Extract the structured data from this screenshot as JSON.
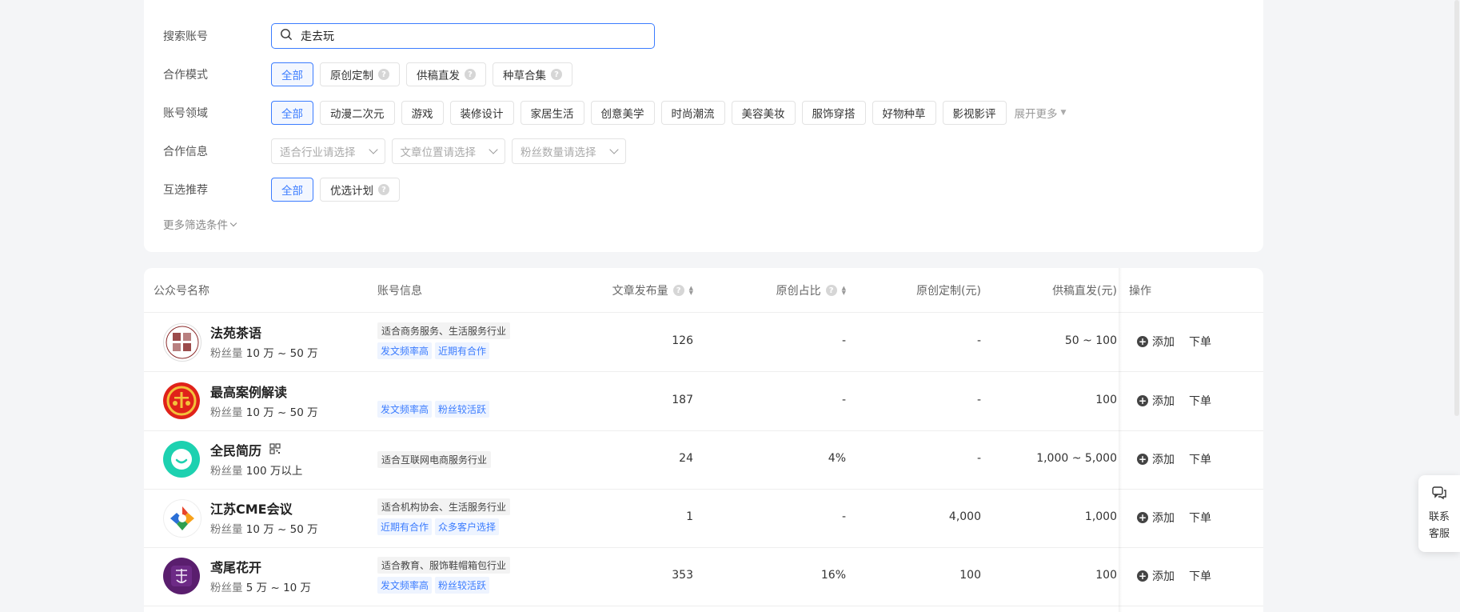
{
  "filters": {
    "search": {
      "label": "搜索账号",
      "value": "走去玩"
    },
    "coop_mode": {
      "label": "合作模式",
      "options": [
        {
          "label": "全部",
          "active": true,
          "help": false
        },
        {
          "label": "原创定制",
          "active": false,
          "help": true
        },
        {
          "label": "供稿直发",
          "active": false,
          "help": true
        },
        {
          "label": "种草合集",
          "active": false,
          "help": true
        }
      ]
    },
    "domain": {
      "label": "账号领域",
      "options": [
        "全部",
        "动漫二次元",
        "游戏",
        "装修设计",
        "家居生活",
        "创意美学",
        "时尚潮流",
        "美容美妆",
        "服饰穿搭",
        "好物种草",
        "影视影评"
      ],
      "expand_label": "展开更多"
    },
    "coop_info": {
      "label": "合作信息",
      "selects": [
        "适合行业请选择",
        "文章位置请选择",
        "粉丝数量请选择"
      ]
    },
    "recommend": {
      "label": "互选推荐",
      "options": [
        {
          "label": "全部",
          "active": true,
          "help": false
        },
        {
          "label": "优选计划",
          "active": false,
          "help": true
        }
      ]
    },
    "more_filters": "更多筛选条件"
  },
  "table": {
    "headers": {
      "name": "公众号名称",
      "info": "账号信息",
      "published": "文章发布量",
      "original_ratio": "原创占比",
      "custom_price": "原创定制(元)",
      "supply_price": "供稿直发(元)",
      "ops": "操作"
    },
    "fans_prefix": "粉丝量",
    "add_label": "添加",
    "order_label": "下单",
    "rows": [
      {
        "name": "法苑茶语",
        "fans": "10 万 ~ 50 万",
        "industry": "适合商务服务、生活服务行业",
        "tags": [
          "发文频率高",
          "近期有合作"
        ],
        "published": "126",
        "original_ratio": "-",
        "custom_price": "-",
        "supply_price": "50 ~ 100",
        "avatar": "fayuan-logo"
      },
      {
        "name": "最高案例解读",
        "fans": "10 万 ~ 50 万",
        "industry": "",
        "tags": [
          "发文频率高",
          "粉丝较活跃"
        ],
        "published": "187",
        "original_ratio": "-",
        "custom_price": "-",
        "supply_price": "100",
        "avatar": "court-emblem"
      },
      {
        "name": "全民简历",
        "fans": "100 万以上",
        "industry": "适合互联网电商服务行业",
        "tags": [],
        "published": "24",
        "original_ratio": "4%",
        "custom_price": "-",
        "supply_price": "1,000 ~ 5,000",
        "avatar": "smile-logo",
        "qrcode": true
      },
      {
        "name": "江苏CME会议",
        "fans": "10 万 ~ 50 万",
        "industry": "适合机构协会、生活服务行业",
        "tags": [
          "近期有合作",
          "众多客户选择"
        ],
        "published": "1",
        "original_ratio": "-",
        "custom_price": "4,000",
        "supply_price": "1,000",
        "avatar": "cme-logo"
      },
      {
        "name": "鸢尾花开",
        "fans": "5 万 ~ 10 万",
        "industry": "适合教育、服饰鞋帽箱包行业",
        "tags": [
          "发文频率高",
          "粉丝较活跃"
        ],
        "published": "353",
        "original_ratio": "16%",
        "custom_price": "100",
        "supply_price": "100",
        "avatar": "iris-logo"
      }
    ]
  },
  "support": {
    "label": "联系客服"
  },
  "colors": {
    "accent": "#3b7cff",
    "tag_bg": "#eef4ff"
  }
}
